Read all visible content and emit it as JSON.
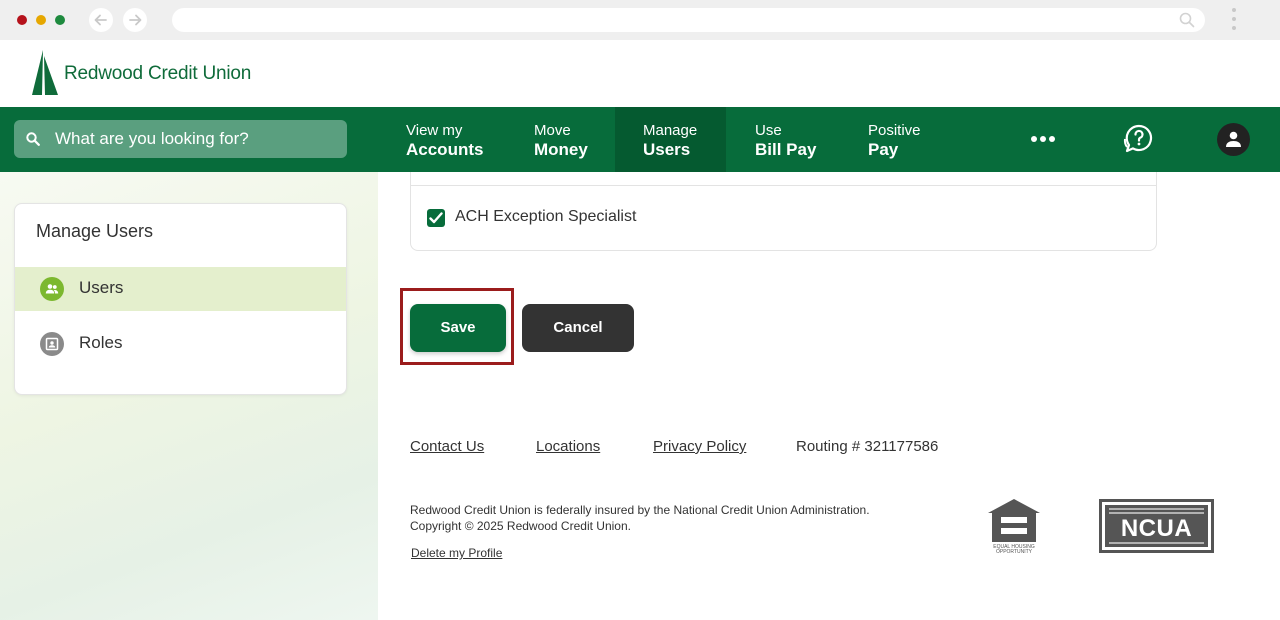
{
  "browser": {
    "url": ""
  },
  "header": {
    "logo_text": "Redwood Credit Union"
  },
  "nav": {
    "search_placeholder": "What are you looking for?",
    "items": [
      {
        "line1": "View my",
        "line2": "Accounts"
      },
      {
        "line1": "Move",
        "line2": "Money"
      },
      {
        "line1": "Manage",
        "line2": "Users"
      },
      {
        "line1": "Use",
        "line2": "Bill Pay"
      },
      {
        "line1": "Positive",
        "line2": "Pay"
      }
    ],
    "active_item": "Manage Users",
    "icons": [
      "more-icon",
      "help-chat-icon",
      "profile-icon"
    ]
  },
  "sidebar": {
    "title": "Manage Users",
    "items": [
      {
        "label": "Users",
        "icon": "users-icon",
        "active": true
      },
      {
        "label": "Roles",
        "icon": "roles-icon",
        "active": false
      }
    ]
  },
  "main": {
    "role_option": {
      "label": "ACH Exception Specialist",
      "checked": true
    },
    "save_label": "Save",
    "cancel_label": "Cancel"
  },
  "footer": {
    "links": [
      "Contact Us",
      "Locations",
      "Privacy Policy"
    ],
    "routing": "Routing # 321177586",
    "legal_line1": "Redwood Credit Union is federally insured by the National Credit Union Administration.",
    "legal_line2": "Copyright © 2025 Redwood Credit Union.",
    "delete_profile": "Delete my Profile",
    "eho_text": "EQUAL HOUSING OPPORTUNITY",
    "ncua_text": "NCUA"
  },
  "colors": {
    "brand_green": "#076c3b",
    "highlight_red": "#9b1c1c",
    "cancel_dark": "#333333"
  }
}
